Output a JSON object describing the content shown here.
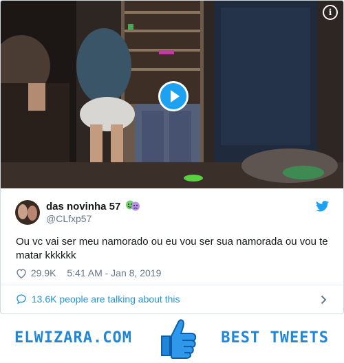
{
  "media": {
    "info_icon": "info-icon",
    "play_icon": "play-icon",
    "info_glyph": "i"
  },
  "tweet": {
    "display_name": "das novinha 57",
    "name_emoji": "performing-arts-masks-emoji",
    "handle": "@CLfxp57",
    "text": "Ou vc vai ser meu namorado ou eu vou ser sua namorada ou vou te matar kkkkkk",
    "likes": "29.9K",
    "timestamp": "5:41 AM - Jan 8, 2019",
    "talking": "13.6K people are talking about this"
  },
  "banner": {
    "left_text": "ELWIZARA.COM",
    "right_text": "BEST TWEETS"
  },
  "colors": {
    "twitter_blue": "#1da1f2",
    "link_blue": "#1b95e0",
    "brand_blue": "#1f86d9",
    "gray_text": "#657786"
  }
}
